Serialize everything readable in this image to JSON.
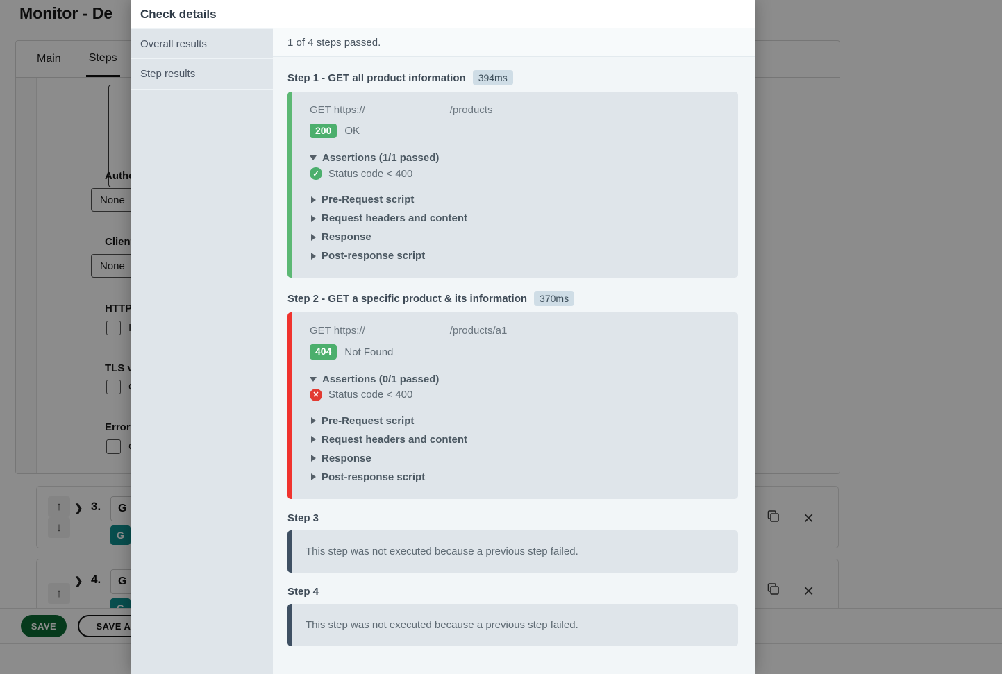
{
  "background": {
    "page_title": "Monitor - De",
    "tabs": [
      {
        "label": "Main",
        "active": false
      },
      {
        "label": "Steps",
        "active": true
      }
    ],
    "fields": [
      {
        "label": "Authe",
        "value": "None"
      },
      {
        "label": "Client",
        "value": "None"
      }
    ],
    "checkboxes": [
      {
        "label": "HTTP",
        "option": "Ig"
      },
      {
        "label": "TLS v",
        "option": "O"
      },
      {
        "label": "Error",
        "option": "C"
      }
    ],
    "steps": [
      {
        "number": "3.",
        "method_text": "G",
        "chip": "G"
      },
      {
        "number": "4.",
        "method_text": "G",
        "chip": "G"
      }
    ],
    "buttons": {
      "save": "SAVE",
      "save_as": "SAVE AS"
    },
    "icons": {
      "up_arrow": "↑",
      "down_arrow": "↓",
      "expand_caret": "❯",
      "close": "×"
    }
  },
  "modal": {
    "title": "Check details",
    "sidebar": {
      "items": [
        {
          "label": "Overall results"
        },
        {
          "label": "Step results"
        }
      ]
    },
    "overall_summary": "1 of 4 steps passed.",
    "steps": [
      {
        "heading": "Step 1 - GET all product information",
        "duration": "394ms",
        "status": "passed",
        "executed": true,
        "request_prefix": "GET https://",
        "request_path": "/products",
        "status_code": "200",
        "status_text": "OK",
        "assertions_label": "Assertions (1/1 passed)",
        "assertions": [
          {
            "text": "Status code < 400",
            "result": "pass"
          }
        ],
        "sections": [
          "Pre-Request script",
          "Request headers and content",
          "Response",
          "Post-response script"
        ]
      },
      {
        "heading": "Step 2 - GET a specific product & its information",
        "duration": "370ms",
        "status": "failed",
        "executed": true,
        "request_prefix": "GET https://",
        "request_path": "/products/a1",
        "status_code": "404",
        "status_text": "Not Found",
        "assertions_label": "Assertions (0/1 passed)",
        "assertions": [
          {
            "text": "Status code < 400",
            "result": "fail"
          }
        ],
        "sections": [
          "Pre-Request script",
          "Request headers and content",
          "Response",
          "Post-response script"
        ]
      },
      {
        "heading": "Step 3",
        "duration": "",
        "status": "skipped",
        "executed": false,
        "skip_message": "This step was not executed because a previous step failed."
      },
      {
        "heading": "Step 4",
        "duration": "",
        "status": "skipped",
        "executed": false,
        "skip_message": "This step was not executed because a previous step failed."
      }
    ],
    "icons": {
      "pass": "✓",
      "fail": "✕"
    }
  },
  "colors": {
    "pass_green": "#5cb874",
    "fail_red": "#f0332e",
    "skip_slate": "#3f5063",
    "badge_green": "#4caf6d",
    "duration_badge_bg": "#cfdde6",
    "panel_bg": "#dfe5ea",
    "content_bg": "#f2f6f8",
    "save_green": "#0b6b34",
    "method_chip_teal": "#0f8f8f"
  }
}
